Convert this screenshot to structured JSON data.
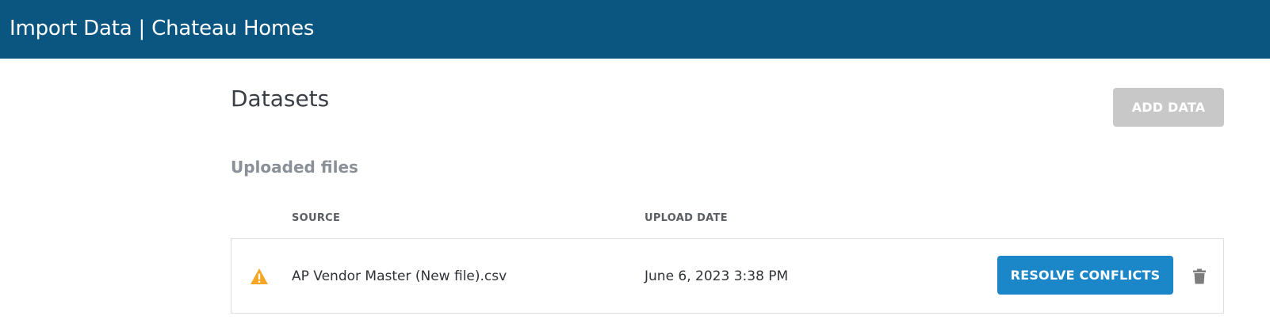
{
  "header": {
    "title": "Import Data | Chateau Homes"
  },
  "page": {
    "title": "Datasets",
    "add_data_label": "ADD DATA",
    "section_title": "Uploaded files"
  },
  "table": {
    "columns": [
      "SOURCE",
      "UPLOAD DATE"
    ],
    "rows": [
      {
        "status_icon": "warning-icon",
        "source": "AP Vendor Master (New file).csv",
        "upload_date": "June 6, 2023 3:38 PM",
        "action_label": "RESOLVE CONFLICTS",
        "delete_icon": "trash-icon"
      }
    ]
  },
  "colors": {
    "header_bg": "#0b5680",
    "primary_button": "#1b87c9",
    "disabled_button": "#c8c8c8",
    "warning": "#f5a623"
  }
}
